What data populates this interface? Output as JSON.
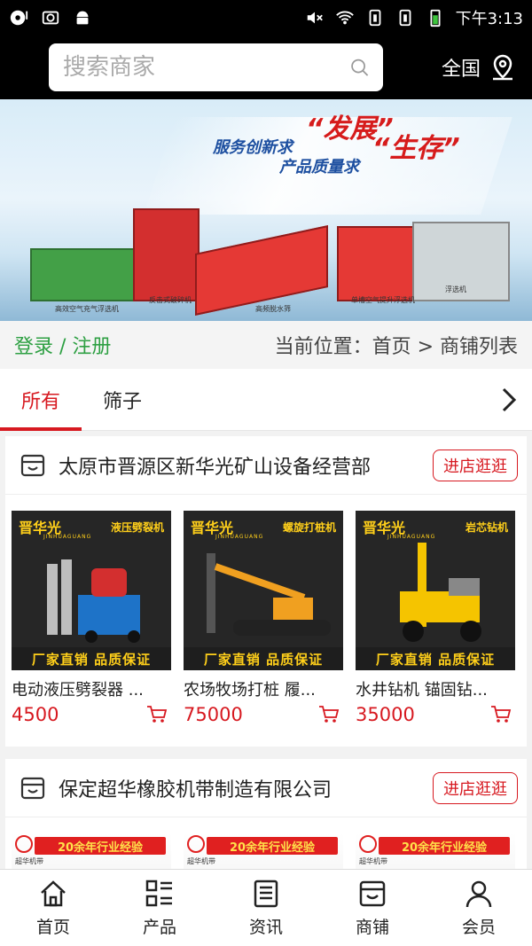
{
  "status_bar": {
    "time": "下午3:13",
    "icons": [
      "disc-icon",
      "screenshot-icon",
      "android-icon",
      "mute-icon",
      "wifi-icon",
      "sim1-icon",
      "sim2-icon",
      "battery-icon"
    ]
  },
  "search": {
    "placeholder": "搜索商家",
    "region_label": "全国"
  },
  "banner": {
    "slogan_1": "服务创新求",
    "slogan_2": "“发展”",
    "slogan_3": "产品质量求",
    "slogan_4": "“生存”",
    "machine_labels": [
      "高效空气充气浮选机",
      "反击式破碎机",
      "高频脱水筛",
      "单槽空气提升浮选机",
      "浮选机"
    ]
  },
  "breadcrumb": {
    "login_label": "登录 / 注册",
    "location_text": "当前位置：首页 > 商铺列表"
  },
  "tabs": [
    {
      "label": "所有",
      "active": true
    },
    {
      "label": "筛子",
      "active": false
    }
  ],
  "shops": [
    {
      "name": "太原市晋源区新华光矿山设备经营部",
      "visit_label": "进店逛逛",
      "products": [
        {
          "title": "电动液压劈裂器 ...",
          "price": "4500",
          "brand": "晋华光",
          "brand_sub": "JINHUAGUANG",
          "tag": "液压劈裂机",
          "strip": "厂家直销  品质保证"
        },
        {
          "title": "农场牧场打桩 履...",
          "price": "75000",
          "brand": "晋华光",
          "brand_sub": "JINHUAGUANG",
          "tag": "螺旋打桩机",
          "strip": "厂家直销  品质保证"
        },
        {
          "title": "水井钻机 锚固钻...",
          "price": "35000",
          "brand": "晋华光",
          "brand_sub": "JINHUAGUANG",
          "tag": "岩芯钻机",
          "strip": "厂家直销  品质保证"
        }
      ]
    },
    {
      "name": "保定超华橡胶机带制造有限公司",
      "visit_label": "进店逛逛",
      "products": [
        {
          "banner": "20余年行业经验",
          "sub": "超华机带"
        },
        {
          "banner": "20余年行业经验",
          "sub": "超华机带"
        },
        {
          "banner": "20余年行业经验",
          "sub": "超华机带"
        }
      ]
    }
  ],
  "bottom_nav": [
    {
      "label": "首页",
      "icon": "home-icon"
    },
    {
      "label": "产品",
      "icon": "grid-list-icon"
    },
    {
      "label": "资讯",
      "icon": "news-icon"
    },
    {
      "label": "商铺",
      "icon": "store-icon"
    },
    {
      "label": "会员",
      "icon": "user-icon"
    }
  ],
  "colors": {
    "accent": "#d71920",
    "login_green": "#2ea043",
    "status_bar": "#000000"
  }
}
